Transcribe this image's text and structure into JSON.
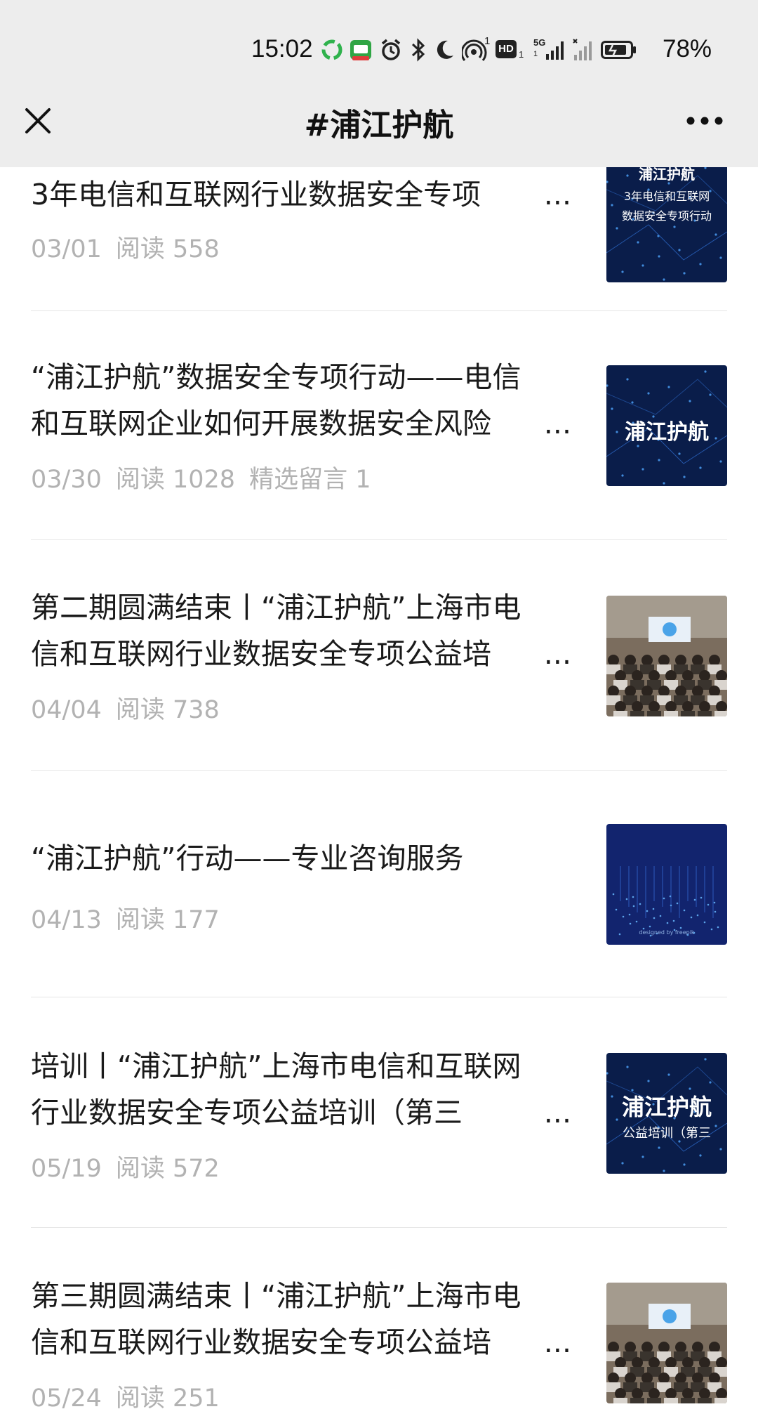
{
  "status_bar": {
    "time": "15:02",
    "battery": "78%",
    "icons": [
      "recycle-app-icon",
      "app-badge-icon",
      "alarm-icon",
      "bluetooth-icon",
      "moon-icon",
      "hotspot-icon",
      "hd-icon",
      "signal-5g-icon",
      "signal-icon",
      "battery-icon"
    ],
    "hotspot_badge": "1",
    "hd_label": "HD",
    "hd_sub": "1",
    "net_label": "5G",
    "net_sub": "1"
  },
  "nav": {
    "title": "#浦江护航",
    "close_icon": "close-icon",
    "more_icon": "more-icon"
  },
  "articles": [
    {
      "title_lines": [
        "3年电信和互联网行业数据安全专项"
      ],
      "truncated": true,
      "date": "03/01",
      "reads": "阅读 558",
      "extra": "",
      "thumb": {
        "type": "banner",
        "text1": "浦江护航",
        "text2": "3年电信和互联网",
        "text3": "数据安全专项行动"
      }
    },
    {
      "title_lines": [
        "“浦江护航”数据安全专项行动——电信",
        "和互联网企业如何开展数据安全风险"
      ],
      "truncated": true,
      "date": "03/30",
      "reads": "阅读 1028",
      "extra": "精选留言 1",
      "thumb": {
        "type": "logo",
        "text1": "浦江护航"
      }
    },
    {
      "title_lines": [
        "第二期圆满结束丨“浦江护航”上海市电",
        "信和互联网行业数据安全专项公益培"
      ],
      "truncated": true,
      "date": "04/04",
      "reads": "阅读 738",
      "extra": "",
      "thumb": {
        "type": "photo"
      }
    },
    {
      "title_lines": [
        "“浦江护航”行动——专业咨询服务"
      ],
      "truncated": false,
      "date": "04/13",
      "reads": "阅读 177",
      "extra": "",
      "thumb": {
        "type": "abstract",
        "caption": "designed by freepik"
      }
    },
    {
      "title_lines": [
        "培训丨“浦江护航”上海市电信和互联网",
        "行业数据安全专项公益培训（第三"
      ],
      "truncated": true,
      "date": "05/19",
      "reads": "阅读 572",
      "extra": "",
      "thumb": {
        "type": "banner2",
        "text1": "浦江护航",
        "text2": "公益培训（第三"
      }
    },
    {
      "title_lines": [
        "第三期圆满结束丨“浦江护航”上海市电",
        "信和互联网行业数据安全专项公益培"
      ],
      "truncated": true,
      "date": "05/24",
      "reads": "阅读 251",
      "extra": "",
      "thumb": {
        "type": "photo2"
      }
    }
  ],
  "colors": {
    "header_bg": "#ededed",
    "meta_text": "#b2b2b2",
    "title_text": "#1a1a1a",
    "thumb_dark_blue": "#0b2150"
  }
}
